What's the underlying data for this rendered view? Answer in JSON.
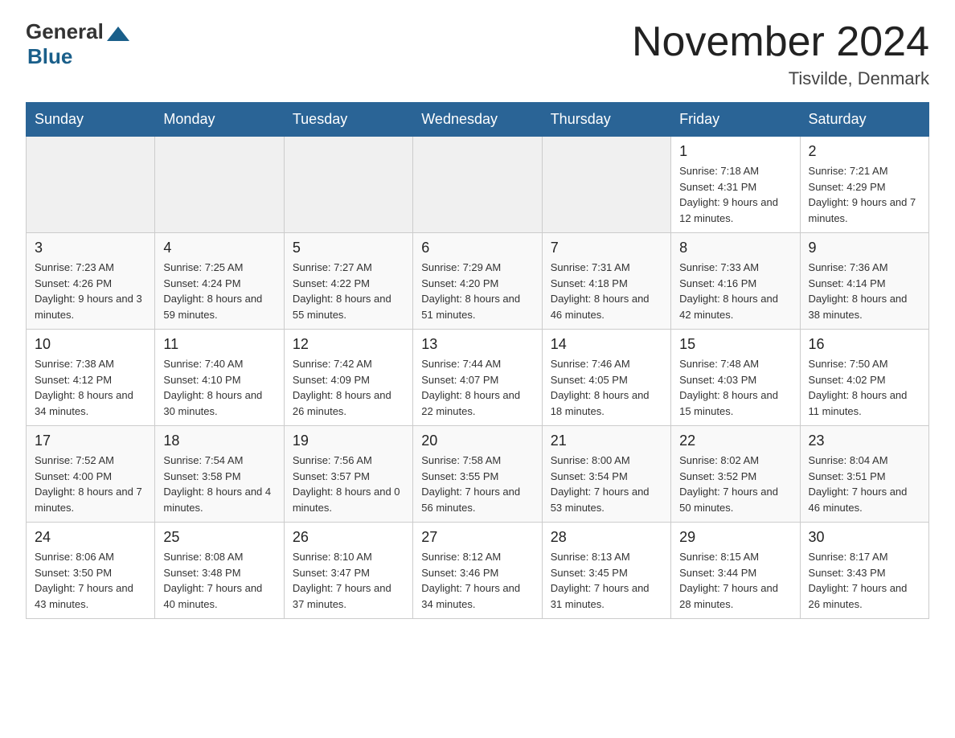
{
  "header": {
    "logo_general": "General",
    "logo_blue": "Blue",
    "month_title": "November 2024",
    "location": "Tisvilde, Denmark"
  },
  "days_of_week": [
    "Sunday",
    "Monday",
    "Tuesday",
    "Wednesday",
    "Thursday",
    "Friday",
    "Saturday"
  ],
  "weeks": [
    [
      {
        "day": "",
        "info": "",
        "empty": true
      },
      {
        "day": "",
        "info": "",
        "empty": true
      },
      {
        "day": "",
        "info": "",
        "empty": true
      },
      {
        "day": "",
        "info": "",
        "empty": true
      },
      {
        "day": "",
        "info": "",
        "empty": true
      },
      {
        "day": "1",
        "info": "Sunrise: 7:18 AM\nSunset: 4:31 PM\nDaylight: 9 hours\nand 12 minutes."
      },
      {
        "day": "2",
        "info": "Sunrise: 7:21 AM\nSunset: 4:29 PM\nDaylight: 9 hours\nand 7 minutes."
      }
    ],
    [
      {
        "day": "3",
        "info": "Sunrise: 7:23 AM\nSunset: 4:26 PM\nDaylight: 9 hours\nand 3 minutes."
      },
      {
        "day": "4",
        "info": "Sunrise: 7:25 AM\nSunset: 4:24 PM\nDaylight: 8 hours\nand 59 minutes."
      },
      {
        "day": "5",
        "info": "Sunrise: 7:27 AM\nSunset: 4:22 PM\nDaylight: 8 hours\nand 55 minutes."
      },
      {
        "day": "6",
        "info": "Sunrise: 7:29 AM\nSunset: 4:20 PM\nDaylight: 8 hours\nand 51 minutes."
      },
      {
        "day": "7",
        "info": "Sunrise: 7:31 AM\nSunset: 4:18 PM\nDaylight: 8 hours\nand 46 minutes."
      },
      {
        "day": "8",
        "info": "Sunrise: 7:33 AM\nSunset: 4:16 PM\nDaylight: 8 hours\nand 42 minutes."
      },
      {
        "day": "9",
        "info": "Sunrise: 7:36 AM\nSunset: 4:14 PM\nDaylight: 8 hours\nand 38 minutes."
      }
    ],
    [
      {
        "day": "10",
        "info": "Sunrise: 7:38 AM\nSunset: 4:12 PM\nDaylight: 8 hours\nand 34 minutes."
      },
      {
        "day": "11",
        "info": "Sunrise: 7:40 AM\nSunset: 4:10 PM\nDaylight: 8 hours\nand 30 minutes."
      },
      {
        "day": "12",
        "info": "Sunrise: 7:42 AM\nSunset: 4:09 PM\nDaylight: 8 hours\nand 26 minutes."
      },
      {
        "day": "13",
        "info": "Sunrise: 7:44 AM\nSunset: 4:07 PM\nDaylight: 8 hours\nand 22 minutes."
      },
      {
        "day": "14",
        "info": "Sunrise: 7:46 AM\nSunset: 4:05 PM\nDaylight: 8 hours\nand 18 minutes."
      },
      {
        "day": "15",
        "info": "Sunrise: 7:48 AM\nSunset: 4:03 PM\nDaylight: 8 hours\nand 15 minutes."
      },
      {
        "day": "16",
        "info": "Sunrise: 7:50 AM\nSunset: 4:02 PM\nDaylight: 8 hours\nand 11 minutes."
      }
    ],
    [
      {
        "day": "17",
        "info": "Sunrise: 7:52 AM\nSunset: 4:00 PM\nDaylight: 8 hours\nand 7 minutes."
      },
      {
        "day": "18",
        "info": "Sunrise: 7:54 AM\nSunset: 3:58 PM\nDaylight: 8 hours\nand 4 minutes."
      },
      {
        "day": "19",
        "info": "Sunrise: 7:56 AM\nSunset: 3:57 PM\nDaylight: 8 hours\nand 0 minutes."
      },
      {
        "day": "20",
        "info": "Sunrise: 7:58 AM\nSunset: 3:55 PM\nDaylight: 7 hours\nand 56 minutes."
      },
      {
        "day": "21",
        "info": "Sunrise: 8:00 AM\nSunset: 3:54 PM\nDaylight: 7 hours\nand 53 minutes."
      },
      {
        "day": "22",
        "info": "Sunrise: 8:02 AM\nSunset: 3:52 PM\nDaylight: 7 hours\nand 50 minutes."
      },
      {
        "day": "23",
        "info": "Sunrise: 8:04 AM\nSunset: 3:51 PM\nDaylight: 7 hours\nand 46 minutes."
      }
    ],
    [
      {
        "day": "24",
        "info": "Sunrise: 8:06 AM\nSunset: 3:50 PM\nDaylight: 7 hours\nand 43 minutes."
      },
      {
        "day": "25",
        "info": "Sunrise: 8:08 AM\nSunset: 3:48 PM\nDaylight: 7 hours\nand 40 minutes."
      },
      {
        "day": "26",
        "info": "Sunrise: 8:10 AM\nSunset: 3:47 PM\nDaylight: 7 hours\nand 37 minutes."
      },
      {
        "day": "27",
        "info": "Sunrise: 8:12 AM\nSunset: 3:46 PM\nDaylight: 7 hours\nand 34 minutes."
      },
      {
        "day": "28",
        "info": "Sunrise: 8:13 AM\nSunset: 3:45 PM\nDaylight: 7 hours\nand 31 minutes."
      },
      {
        "day": "29",
        "info": "Sunrise: 8:15 AM\nSunset: 3:44 PM\nDaylight: 7 hours\nand 28 minutes."
      },
      {
        "day": "30",
        "info": "Sunrise: 8:17 AM\nSunset: 3:43 PM\nDaylight: 7 hours\nand 26 minutes."
      }
    ]
  ]
}
